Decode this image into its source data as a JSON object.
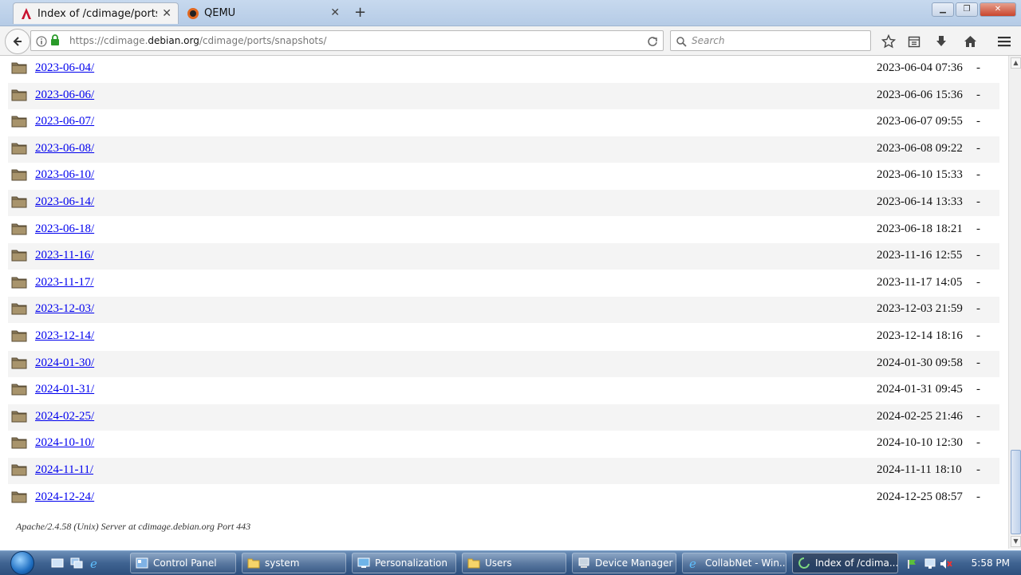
{
  "browser": {
    "tabs": [
      {
        "title": "Index of /cdimage/ports/sn",
        "active": true,
        "icon": "debian-icon"
      },
      {
        "title": "QEMU",
        "active": false,
        "icon": "qemu-icon"
      }
    ],
    "new_tab": "+",
    "close_tab": "✕",
    "url_prefix": "https://cdimage.",
    "url_domain": "debian.org",
    "url_path": "/cdimage/ports/snapshots/",
    "search_placeholder": "Search"
  },
  "listing": {
    "rows": [
      {
        "name": "2023-06-04/",
        "date": "2023-06-04 07:36",
        "size": "-"
      },
      {
        "name": "2023-06-06/",
        "date": "2023-06-06 15:36",
        "size": "-"
      },
      {
        "name": "2023-06-07/",
        "date": "2023-06-07 09:55",
        "size": "-"
      },
      {
        "name": "2023-06-08/",
        "date": "2023-06-08 09:22",
        "size": "-"
      },
      {
        "name": "2023-06-10/",
        "date": "2023-06-10 15:33",
        "size": "-"
      },
      {
        "name": "2023-06-14/",
        "date": "2023-06-14 13:33",
        "size": "-"
      },
      {
        "name": "2023-06-18/",
        "date": "2023-06-18 18:21",
        "size": "-"
      },
      {
        "name": "2023-11-16/",
        "date": "2023-11-16 12:55",
        "size": "-"
      },
      {
        "name": "2023-11-17/",
        "date": "2023-11-17 14:05",
        "size": "-"
      },
      {
        "name": "2023-12-03/",
        "date": "2023-12-03 21:59",
        "size": "-"
      },
      {
        "name": "2023-12-14/",
        "date": "2023-12-14 18:16",
        "size": "-"
      },
      {
        "name": "2024-01-30/",
        "date": "2024-01-30 09:58",
        "size": "-"
      },
      {
        "name": "2024-01-31/",
        "date": "2024-01-31 09:45",
        "size": "-"
      },
      {
        "name": "2024-02-25/",
        "date": "2024-02-25 21:46",
        "size": "-"
      },
      {
        "name": "2024-10-10/",
        "date": "2024-10-10 12:30",
        "size": "-"
      },
      {
        "name": "2024-11-11/",
        "date": "2024-11-11 18:10",
        "size": "-"
      },
      {
        "name": "2024-12-24/",
        "date": "2024-12-25 08:57",
        "size": "-"
      }
    ],
    "footer": "Apache/2.4.58 (Unix) Server at cdimage.debian.org Port 443"
  },
  "taskbar": {
    "buttons": [
      {
        "label": "Control Panel",
        "icon": "control-panel-icon",
        "active": false
      },
      {
        "label": "system",
        "icon": "folder-icon",
        "active": false
      },
      {
        "label": "Personalization",
        "icon": "personalization-icon",
        "active": false
      },
      {
        "label": "Users",
        "icon": "folder-icon",
        "active": false
      },
      {
        "label": "Device Manager",
        "icon": "device-manager-icon",
        "active": false
      },
      {
        "label": "CollabNet - Win...",
        "icon": "ie-icon",
        "active": false
      },
      {
        "label": "Index of /cdima...",
        "icon": "browser-icon",
        "active": true
      }
    ],
    "clock": "5:58 PM"
  }
}
